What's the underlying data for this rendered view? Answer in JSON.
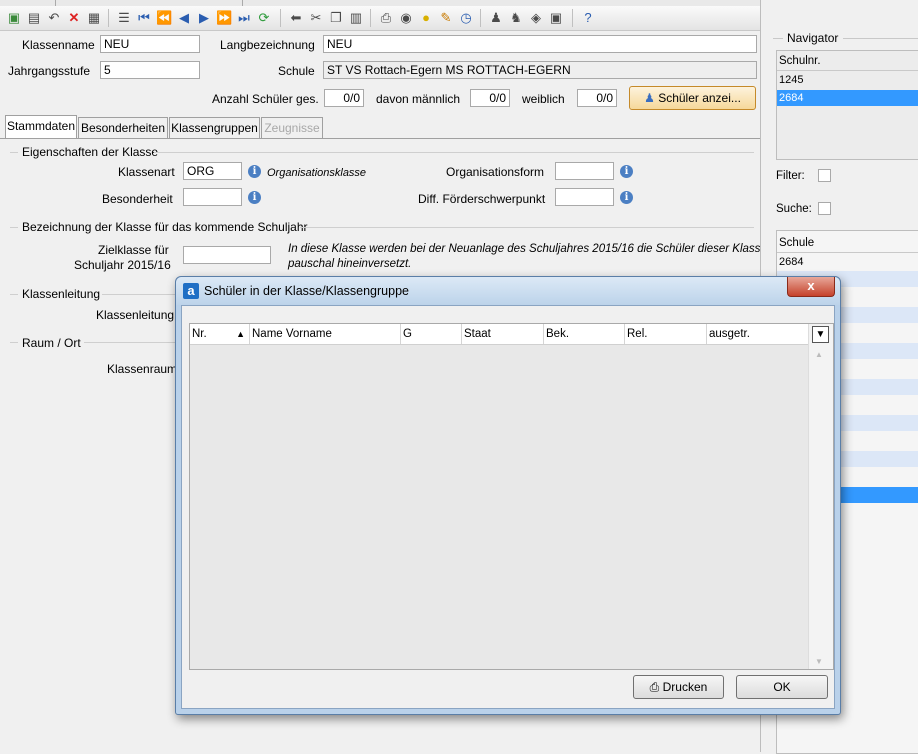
{
  "form": {
    "klassenname_label": "Klassenname",
    "klassenname_value": "NEU",
    "langbezeichnung_label": "Langbezeichnung",
    "langbezeichnung_value": "NEU",
    "jahrgangsstufe_label": "Jahrgangsstufe",
    "jahrgangsstufe_value": "5",
    "schule_label": "Schule",
    "schule_value": "ST VS Rottach-Egern MS ROTTACH-EGERN",
    "anzahl_label": "Anzahl Schüler ges.",
    "anzahl_value": "0/0",
    "maennlich_label": "davon männlich",
    "maennlich_value": "0/0",
    "weiblich_label": "weiblich",
    "weiblich_value": "0/0",
    "schueler_button": "Schüler anzei..."
  },
  "tabs": [
    {
      "label": "Stammdaten",
      "state": "active"
    },
    {
      "label": "Besonderheiten",
      "state": "normal"
    },
    {
      "label": "Klassengruppen",
      "state": "normal"
    },
    {
      "label": "Zeugnisse",
      "state": "disabled"
    }
  ],
  "stammdaten": {
    "section_eigenschaften": "Eigenschaften der Klasse",
    "klassenart_label": "Klassenart",
    "klassenart_value": "ORG",
    "klassenart_hint": "Organisationsklasse",
    "organisationsform_label": "Organisationsform",
    "organisationsform_value": "",
    "besonderheit_label": "Besonderheit",
    "besonderheit_value": "",
    "foerder_label": "Diff. Förderschwerpunkt",
    "foerder_value": "",
    "section_bezeichnung": "Bezeichnung der Klasse für das kommende Schuljahr",
    "zielklasse_label_1": "Zielklasse für",
    "zielklasse_label_2": "Schuljahr 2015/16",
    "zielklasse_value": "",
    "zielklasse_note_1": "In diese Klasse werden bei der Neuanlage des Schuljahres 2015/16 die Schüler dieser Klasse",
    "zielklasse_note_2": "pauschal hineinversetzt.",
    "section_klassenleitung": "Klassenleitung",
    "klassenleitung_label": "Klassenleitung",
    "section_raum": "Raum / Ort",
    "klassenraum_label": "Klassenraum"
  },
  "navigator": {
    "title": "Navigator",
    "column": "Schulnr.",
    "rows": [
      {
        "value": "1245",
        "selected": false
      },
      {
        "value": "2684",
        "selected": true
      }
    ],
    "filter_label": "Filter:",
    "suche_label": "Suche:",
    "schule_column": "Schule",
    "schule_rows": [
      "2684"
    ]
  },
  "toolbar_icons": [
    "new-icon",
    "save-icon",
    "undo-icon",
    "delete-icon",
    "properties-icon",
    "list-icon",
    "first-icon",
    "previous-page-icon",
    "previous-icon",
    "next-icon",
    "next-page-icon",
    "last-icon",
    "refresh-icon",
    "back-arrow-icon",
    "cut-icon",
    "copy-icon",
    "paste-icon",
    "print-icon",
    "preview-icon",
    "hint-icon",
    "clean-icon",
    "clock-icon",
    "users-icon",
    "group-icon",
    "transfer-icon",
    "export-icon",
    "help-icon"
  ],
  "dialog": {
    "title": "Schüler in der Klasse/Klassengruppe",
    "columns": [
      "Nr.",
      "Name Vorname",
      "G",
      "Staat",
      "Bek.",
      "Rel.",
      "ausgetr."
    ],
    "rows": [],
    "print_button": "Drucken",
    "ok_button": "OK",
    "close_symbol": "x"
  },
  "colors": {
    "selection": "#3399ff",
    "info_icon": "#4b7fc3",
    "dialog_frame": "#b9d1ea"
  }
}
